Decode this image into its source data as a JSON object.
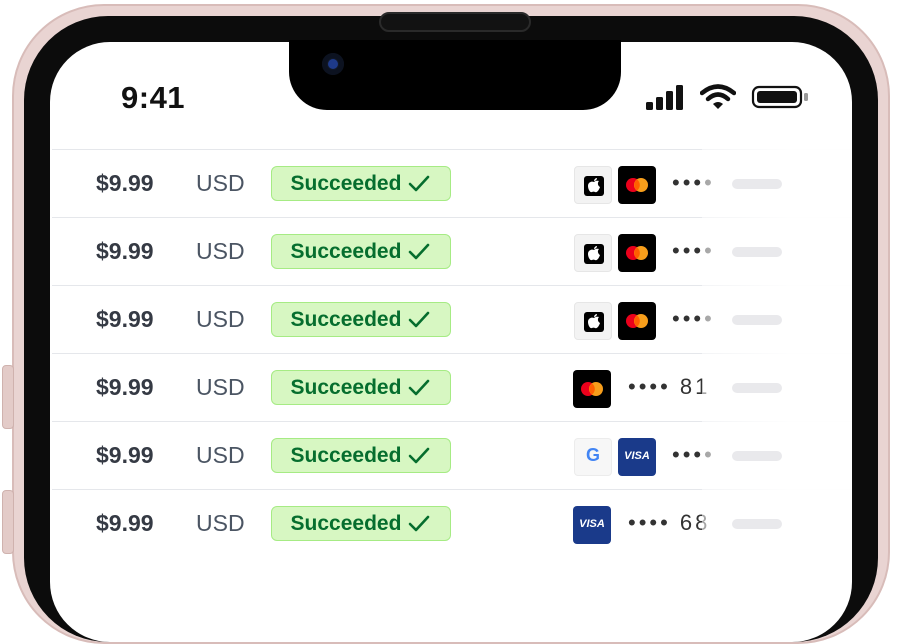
{
  "status_bar": {
    "time": "9:41",
    "icons": [
      "signal-icon",
      "wifi-icon",
      "battery-icon"
    ]
  },
  "colors": {
    "badge_bg": "#d7f7c2",
    "badge_border": "#a6eb84",
    "badge_text": "#066e2e",
    "mastercard_red": "#eb001b",
    "mastercard_orange": "#f79e1b",
    "visa_blue": "#1a3a8a"
  },
  "transactions": [
    {
      "amount": "$9.99",
      "currency": "USD",
      "status": "Succeeded",
      "wallet": "apple-icon",
      "card": "mastercard-icon",
      "masked": "••••"
    },
    {
      "amount": "$9.99",
      "currency": "USD",
      "status": "Succeeded",
      "wallet": "apple-icon",
      "card": "mastercard-icon",
      "masked": "••••"
    },
    {
      "amount": "$9.99",
      "currency": "USD",
      "status": "Succeeded",
      "wallet": "apple-icon",
      "card": "mastercard-icon",
      "masked": "••••"
    },
    {
      "amount": "$9.99",
      "currency": "USD",
      "status": "Succeeded",
      "wallet": "",
      "card": "mastercard-icon",
      "masked": "•••• 81"
    },
    {
      "amount": "$9.99",
      "currency": "USD",
      "status": "Succeeded",
      "wallet": "google-icon",
      "card": "visa-icon",
      "masked": "••••"
    },
    {
      "amount": "$9.99",
      "currency": "USD",
      "status": "Succeeded",
      "wallet": "",
      "card": "visa-icon",
      "masked": "•••• 68"
    }
  ],
  "card_labels": {
    "visa": "VISA",
    "google": "G"
  }
}
